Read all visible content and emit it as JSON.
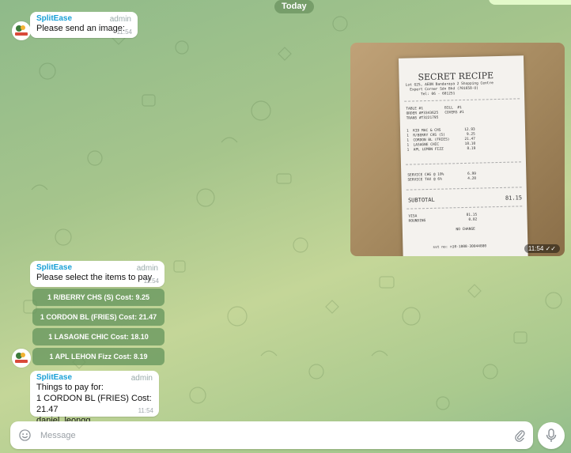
{
  "date_separator": "Today",
  "messages": [
    {
      "sender": "SplitEase",
      "role": "admin",
      "text": "Please send an image:",
      "time": "11:54"
    },
    {
      "sender": "SplitEase",
      "role": "admin",
      "text": "Please select the items to pay",
      "time": "11:54"
    },
    {
      "sender": "SplitEase",
      "role": "admin",
      "text": "Things to pay for:\n1 CORDON BL (FRIES) Cost: 21.47\ndaniel_leongg",
      "time": "11:54"
    }
  ],
  "photo": {
    "time": "11:54",
    "receipt": {
      "title": "SECRET RECIPE",
      "header": "Lot G25, AEON Bandaraya 2 Shopping Centre\n  Expert Corner Sdn Bhd (701658-U)\n       Tel: 06 - 601251",
      "table_info": "TABLE #1          BILL  #1\nORDER #P3343625   COVERS #1\nTRANS #T3221795",
      "items": "1  KID MAC & CHS           12.93\n1  R/BERRY CHS (S)          9.25\n1  CORDON BL (FRIES)       21.47\n1  LASAGNE CHIC            18.10\n1  APL LEMON FIZZ           8.19",
      "charges": "SERVICE CHG @ 10%           6.99\nSERVICE TAX @ 6%            4.20",
      "subtotal_label": "SUBTOTAL",
      "subtotal_value": "81.15",
      "payment": "VISA                       81.15\nROUNDING                    0.02\n\n                      NO CHANGE",
      "footer": "sst no: n10-1808-30044880"
    }
  },
  "inline_buttons": [
    "1 R/BERRY CHS (S) Cost: 9.25",
    "1 CORDON BL (FRIES) Cost: 21.47",
    "1 LASAGNE CHIC Cost: 18.10",
    "1 APL LEHON Fizz Cost: 8.19"
  ],
  "composer": {
    "placeholder": "Message"
  },
  "icons": {
    "emoji": "smiley-icon",
    "attach": "paperclip-icon",
    "mic": "microphone-icon",
    "read_status": "double-check-icon"
  },
  "colors": {
    "sender": "#1aa0d6",
    "button_bg": "#66965e",
    "bubble": "#ffffff"
  }
}
